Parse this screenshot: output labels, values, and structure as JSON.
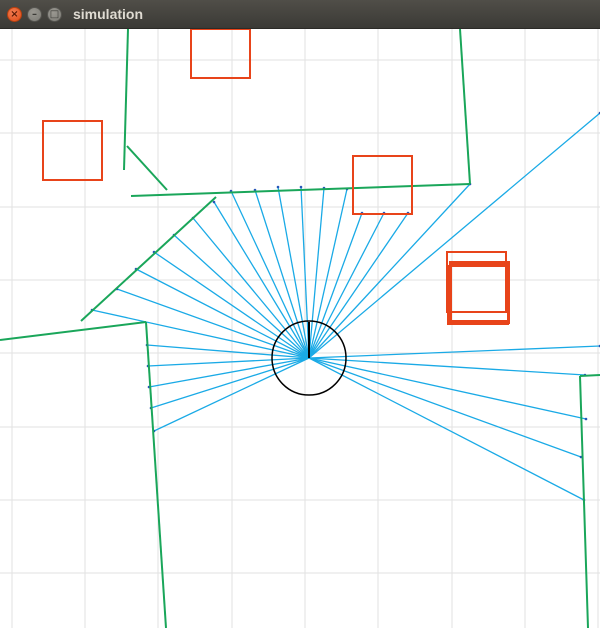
{
  "window": {
    "title": "simulation",
    "close_glyph": "×",
    "minimize_glyph": "–",
    "maximize_glyph": "□"
  },
  "colors": {
    "grid": "#e2e2e2",
    "wall": "#1aa65a",
    "obstacle": "#e8441a",
    "laser": "#1aaae6",
    "laser_hit": "#2855b8",
    "robot": "#000000"
  }
}
